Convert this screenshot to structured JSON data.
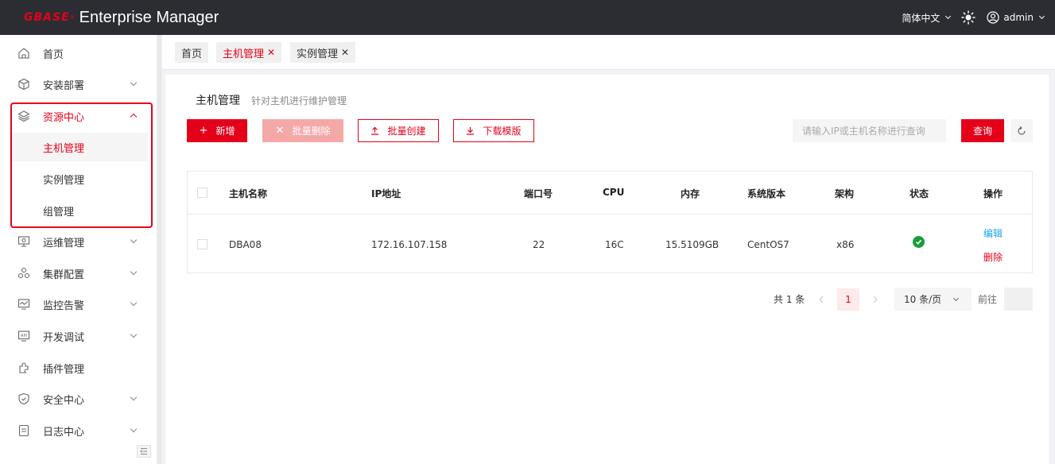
{
  "header": {
    "logo_mark": "GBASE",
    "logo_reg": "®",
    "title": "Enterprise Manager",
    "language": "简体中文",
    "username": "admin"
  },
  "sidebar": {
    "items": [
      {
        "label": "首页",
        "icon": "home-icon"
      },
      {
        "label": "安装部署",
        "icon": "package-icon"
      },
      {
        "label": "资源中心",
        "icon": "layers-icon"
      },
      {
        "label": "运维管理",
        "icon": "monitor-settings-icon"
      },
      {
        "label": "集群配置",
        "icon": "cluster-icon"
      },
      {
        "label": "监控告警",
        "icon": "chart-monitor-icon"
      },
      {
        "label": "开发调试",
        "icon": "api-icon"
      },
      {
        "label": "插件管理",
        "icon": "plugin-icon"
      },
      {
        "label": "安全中心",
        "icon": "shield-icon"
      },
      {
        "label": "日志中心",
        "icon": "log-file-icon"
      }
    ],
    "sub_items": [
      {
        "label": "主机管理"
      },
      {
        "label": "实例管理"
      },
      {
        "label": "组管理"
      }
    ]
  },
  "tabs": [
    {
      "label": "首页",
      "closable": false
    },
    {
      "label": "主机管理",
      "closable": true
    },
    {
      "label": "实例管理",
      "closable": true
    }
  ],
  "close_glyph": "✕",
  "page": {
    "title": "主机管理",
    "description": "针对主机进行维护管理"
  },
  "toolbar": {
    "add_label": "新增",
    "batch_delete_label": "批量删除",
    "batch_create_label": "批量创建",
    "download_template_label": "下载模版",
    "search_placeholder": "请输入IP或主机名称进行查询",
    "query_label": "查询"
  },
  "table": {
    "columns": [
      "主机名称",
      "IP地址",
      "端口号",
      "CPU",
      "内存",
      "系统版本",
      "架构",
      "状态",
      "操作"
    ],
    "rows": [
      {
        "host_name": "DBA08",
        "ip": "172.16.107.158",
        "port": "22",
        "cpu": "16C",
        "memory": "15.5109GB",
        "os": "CentOS7",
        "arch": "x86",
        "status": "online",
        "edit_label": "编辑",
        "delete_label": "删除"
      }
    ]
  },
  "pagination": {
    "total_text": "共 1 条",
    "current_page": "1",
    "page_size_label": "10 条/页",
    "goto_label": "前往"
  },
  "colors": {
    "brand": "#e5001a",
    "header_bg": "#2b2d33",
    "status_ok": "#1a9c3a",
    "link_blue": "#1aa5e6"
  }
}
